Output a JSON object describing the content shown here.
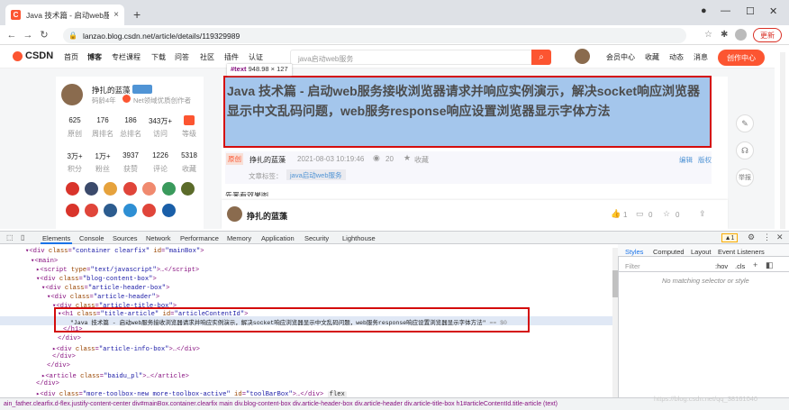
{
  "browser": {
    "tab_title": "Java 技术篇 - 启动web服务接收",
    "url": "lanzao.blog.csdn.net/article/details/119329989",
    "update_label": "更新",
    "new_tab": "+",
    "tab_close": "×"
  },
  "csdn_nav": {
    "logo": "CSDN",
    "items": [
      "首页",
      "博客",
      "专栏课程",
      "下载",
      "问答",
      "社区",
      "插件",
      "认证"
    ],
    "search_placeholder": "java启动web服务",
    "right_items": [
      "会员中心",
      "收藏",
      "动态",
      "消息"
    ],
    "create_label": "创作中心"
  },
  "profile": {
    "name": "挣扎的蓝藻",
    "code_age": "码龄4年",
    "title": "Net领域优质创作者",
    "row1_values": [
      "625",
      "176",
      "186",
      "343万+"
    ],
    "row1_labels": [
      "原创",
      "周排名",
      "总排名",
      "访问",
      "等级"
    ],
    "row2_values": [
      "3万+",
      "1万+",
      "3937",
      "1226",
      "5318"
    ],
    "row2_labels": [
      "积分",
      "粉丝",
      "获赞",
      "评论",
      "收藏"
    ]
  },
  "article": {
    "tooltip_tag": "#text",
    "tooltip_size": "948.98 × 127",
    "title": "Java 技术篇 - 启动web服务接收浏览器请求并响应实例演示，解决socket响应浏览器显示中文乱码问题，web服务response响应设置浏览器显示字体方法",
    "original_badge": "原创",
    "author": "挣扎的蓝藻",
    "date": "2021-08-03 10:19:46",
    "views": "20",
    "favorite": "收藏",
    "edit": "编辑",
    "copyright": "版权",
    "tags_label": "文章标签：",
    "tag": "java启动web服务",
    "preview_line": "先来看效果图",
    "bottom_author": "挣扎的蓝藻",
    "likes": "1",
    "comments": "0",
    "favs": "0",
    "report": "举报"
  },
  "devtools": {
    "tabs": [
      "Elements",
      "Console",
      "Sources",
      "Network",
      "Performance",
      "Memory",
      "Application",
      "Security",
      "Lighthouse"
    ],
    "warning_count": "1",
    "side_tabs": [
      "Styles",
      "Computed",
      "Layout",
      "Event Listeners"
    ],
    "filter_placeholder": "Filter",
    "hov": ":hov",
    "cls": ".cls",
    "no_match": "No matching selector or style",
    "text_node": "\"Java 技术篇 - 启动web服务接收浏览器请求并响应实例演示，解决socket响应浏览器显示中文乱码问题，web服务response响应设置浏览器显示字体方法\"",
    "eq0": "== $0",
    "breadcrumbs": "ain_father.clearfix.d-flex.justify-content-center   div#mainBox.container.clearfix   main   div.blog-content-box   div.article-header-box   div.article-header   div.article-title-box   h1#articleContentId.title-article   (text)",
    "flex_chip": "flex"
  },
  "watermark": "https://blog.csdn.net/qq_38161040"
}
